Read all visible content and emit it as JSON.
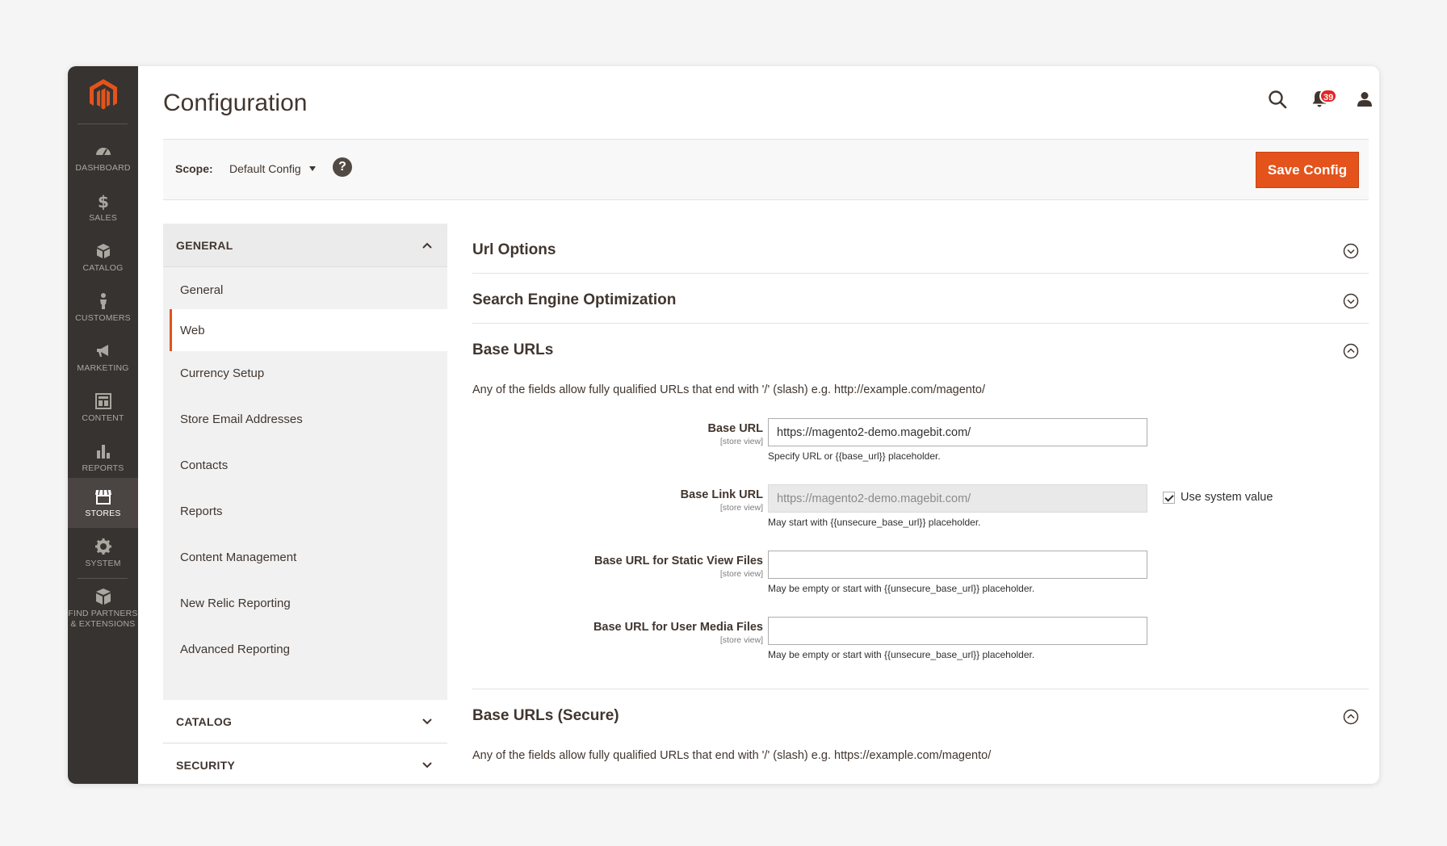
{
  "nav": {
    "items": [
      {
        "label": "DASHBOARD",
        "icon": "dashboard-icon"
      },
      {
        "label": "SALES",
        "icon": "dollar-icon"
      },
      {
        "label": "CATALOG",
        "icon": "box-icon"
      },
      {
        "label": "CUSTOMERS",
        "icon": "person-icon"
      },
      {
        "label": "MARKETING",
        "icon": "megaphone-icon"
      },
      {
        "label": "CONTENT",
        "icon": "layout-icon"
      },
      {
        "label": "REPORTS",
        "icon": "bar-chart-icon"
      },
      {
        "label": "STORES",
        "icon": "storefront-icon",
        "active": true
      },
      {
        "label": "SYSTEM",
        "icon": "gear-icon"
      },
      {
        "label": "FIND PARTNERS",
        "label2": "& EXTENSIONS",
        "icon": "extensions-icon"
      }
    ]
  },
  "header": {
    "title": "Configuration",
    "notifications_count": "39",
    "user": "admin"
  },
  "scope": {
    "label": "Scope:",
    "value": "Default Config",
    "help": "?",
    "save_label": "Save Config"
  },
  "sidebar": {
    "sections": [
      {
        "label": "GENERAL",
        "expanded": true
      },
      {
        "label": "CATALOG",
        "expanded": false
      },
      {
        "label": "SECURITY",
        "expanded": false
      }
    ],
    "items": [
      {
        "label": "General"
      },
      {
        "label": "Web",
        "active": true
      },
      {
        "label": "Currency Setup"
      },
      {
        "label": "Store Email Addresses"
      },
      {
        "label": "Contacts"
      },
      {
        "label": "Reports"
      },
      {
        "label": "Content Management"
      },
      {
        "label": "New Relic Reporting"
      },
      {
        "label": "Advanced Reporting"
      }
    ]
  },
  "sections": {
    "url_options": {
      "title": "Url Options"
    },
    "seo": {
      "title": "Search Engine Optimization"
    },
    "base_urls": {
      "title": "Base URLs",
      "note": "Any of the fields allow fully qualified URLs that end with '/' (slash) e.g. http://example.com/magento/",
      "fields": [
        {
          "label": "Base URL",
          "scope": "[store view]",
          "value": "https://magento2-demo.magebit.com/",
          "hint": "Specify URL or {{base_url}} placeholder."
        },
        {
          "label": "Base Link URL",
          "scope": "[store view]",
          "value": "https://magento2-demo.magebit.com/",
          "hint": "May start with {{unsecure_base_url}} placeholder.",
          "use_system": "Use system value"
        },
        {
          "label": "Base URL for Static View Files",
          "scope": "[store view]",
          "value": "",
          "hint": "May be empty or start with {{unsecure_base_url}} placeholder."
        },
        {
          "label": "Base URL for User Media Files",
          "scope": "[store view]",
          "value": "",
          "hint": "May be empty or start with {{unsecure_base_url}} placeholder."
        }
      ]
    },
    "base_urls_secure": {
      "title": "Base URLs (Secure)",
      "note": "Any of the fields allow fully qualified URLs that end with '/' (slash) e.g. https://example.com/magento/"
    }
  },
  "colors": {
    "accent": "#e3531b",
    "nav_bg": "#373330",
    "badge": "#e22626"
  }
}
